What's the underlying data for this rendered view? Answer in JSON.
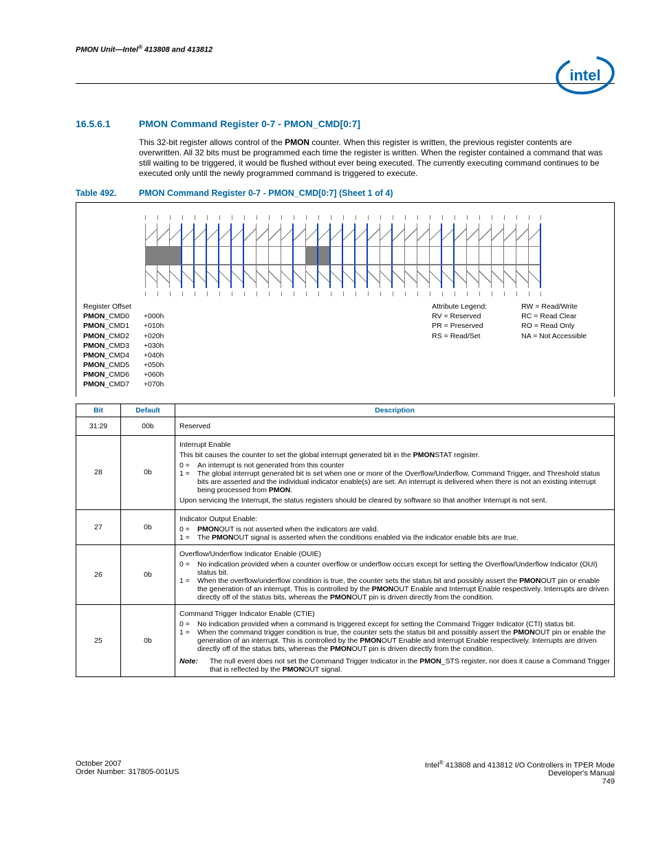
{
  "header": {
    "title_left": "PMON Unit—Intel",
    "title_right": " 413808 and 413812"
  },
  "section": {
    "number": "16.5.6.1",
    "title": "PMON Command Register 0-7 - PMON_CMD[0:7]",
    "paragraph_pre": "This 32-bit register allows control of the ",
    "paragraph_bold": "PMON",
    "paragraph_post": " counter. When this register is written, the previous register contents are overwritten. All 32 bits must be programmed each time the register is written. When the register contained a command that was still waiting to be triggered, it would be flushed without ever being executed. The currently executing command continues to be executed only until the newly programmed command is triggered to execute."
  },
  "table_caption": {
    "label": "Table 492.",
    "title": "PMON Command Register 0-7 - PMON_CMD[0:7] (Sheet 1 of 4)"
  },
  "register_offsets": {
    "header": "Register Offset",
    "rows": [
      {
        "name": "PMON_CMD0",
        "off": "+000h"
      },
      {
        "name": "PMON_CMD1",
        "off": "+010h"
      },
      {
        "name": "PMON_CMD2",
        "off": "+020h"
      },
      {
        "name": "PMON_CMD3",
        "off": "+030h"
      },
      {
        "name": "PMON_CMD4",
        "off": "+040h"
      },
      {
        "name": "PMON_CMD5",
        "off": "+050h"
      },
      {
        "name": "PMON_CMD6",
        "off": "+060h"
      },
      {
        "name": "PMON_CMD7",
        "off": "+070h"
      }
    ]
  },
  "legend": {
    "title": "Attribute Legend:",
    "left": [
      "RV = Reserved",
      "PR = Preserved",
      "RS = Read/Set"
    ],
    "right": [
      "RW = Read/Write",
      "RC = Read Clear",
      "RO = Read Only",
      "NA = Not Accessible"
    ]
  },
  "bit_table": {
    "head": {
      "bit": "Bit",
      "default": "Default",
      "description": "Description"
    },
    "rows": [
      {
        "bit": "31:29",
        "def": "00b",
        "title": "Reserved",
        "lines": []
      },
      {
        "bit": "28",
        "def": "0b",
        "title": "Interrupt Enable",
        "lines": [
          {
            "type": "p",
            "html": "This bit causes the counter to set the global interrupt generated bit in the <b>PMON</b>STAT register."
          },
          {
            "type": "kv",
            "k": "0 =",
            "v": "An interrupt is not generated from this counter"
          },
          {
            "type": "kv",
            "k": "1 =",
            "v": "The global interrupt generated bit is set when one or more of the Overflow/Underflow, Command Trigger, and Threshold status bits are asserted and the individual indicator enable(s) are set. An interrupt is delivered when there is not an existing interrupt being processed from <b>PMON</b>."
          },
          {
            "type": "p",
            "html": "Upon servicing the Interrupt, the status registers should be cleared by software so that another Interrupt is not sent."
          }
        ]
      },
      {
        "bit": "27",
        "def": "0b",
        "title": "Indicator Output Enable:",
        "lines": [
          {
            "type": "kv",
            "k": "0 =",
            "v": "<b>PMON</b>OUT is not asserted when the indicators are valid."
          },
          {
            "type": "kv",
            "k": "1 =",
            "v": "The <b>PMON</b>OUT signal is asserted when the conditions enabled via the indicator enable bits are true."
          }
        ]
      },
      {
        "bit": "26",
        "def": "0b",
        "title": "Overflow/Underflow Indicator Enable (OUIE)",
        "lines": [
          {
            "type": "kv",
            "k": "0 =",
            "v": "No indication provided when a counter overflow or underflow occurs except for setting the Overflow/Underflow Indicator (OUI) status bit."
          },
          {
            "type": "kv",
            "k": "1 =",
            "v": "When the overflow/underflow condition is true, the counter sets the status bit and possibly assert the <b>PMON</b>OUT pin or enable the generation of an interrupt. This is controlled by the <b>PMON</b>OUT Enable and Interrupt Enable respectively. Interrupts are driven directly off of the status bits, whereas the <b>PMON</b>OUT pin is driven directly from the condition."
          }
        ]
      },
      {
        "bit": "25",
        "def": "0b",
        "title": "Command Trigger Indicator Enable (CTIE)",
        "lines": [
          {
            "type": "kv",
            "k": "0 =",
            "v": "No indication provided when a command is triggered except for setting the Command Trigger Indicator (CTI) status bit."
          },
          {
            "type": "kv",
            "k": "1 =",
            "v": "When the command trigger condition is true, the counter sets the status bit and possibly assert the <b>PMON</b>OUT pin or enable the generation of an interrupt. This is controlled by the <b>PMON</b>OUT Enable and Interrupt Enable respectively. Interrupts are driven directly off of the status bits, whereas the <b>PMON</b>OUT pin is driven directly from the condition."
          },
          {
            "type": "note",
            "v": "The null event does not set the Command Trigger Indicator in the <b>PMON</b>_STS register, nor does it cause a Command Trigger that is reflected by the <b>PMON</b>OUT signal."
          }
        ]
      }
    ]
  },
  "footer": {
    "left_line1": "October 2007",
    "left_line2": "Order Number: 317805-001US",
    "right_line1_pre": "Intel",
    "right_line1_post": " 413808 and 413812 I/O Controllers in TPER Mode",
    "right_line2": "Developer's Manual",
    "right_line3": "749"
  },
  "note_label": "Note:"
}
